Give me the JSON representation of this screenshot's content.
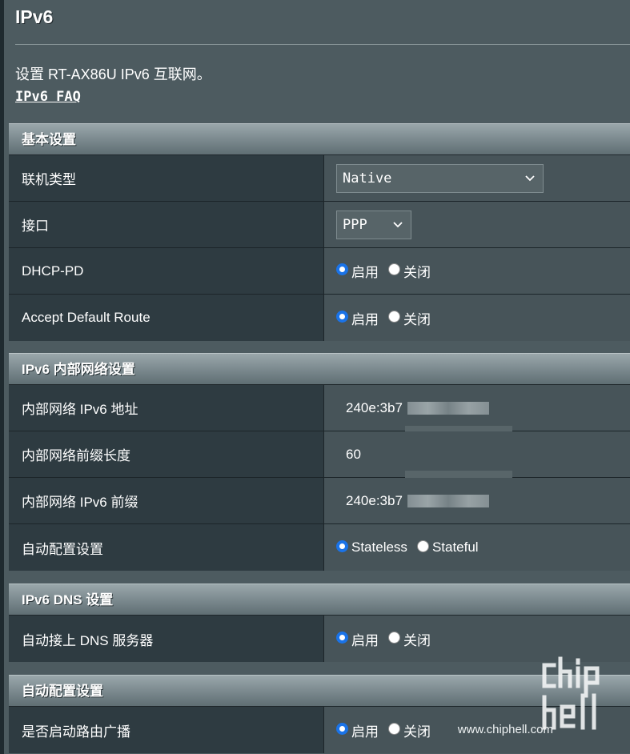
{
  "page": {
    "title": "IPv6",
    "description": "设置 RT-AX86U IPv6 互联网。",
    "faq_link": "IPv6 FAQ"
  },
  "sections": {
    "basic": {
      "header": "基本设置",
      "connection_type_label": "联机类型",
      "connection_type_value": "Native",
      "interface_label": "接口",
      "interface_value": "PPP",
      "dhcp_pd_label": "DHCP-PD",
      "accept_route_label": "Accept Default Route"
    },
    "lan": {
      "header": "IPv6 内部网络设置",
      "address_label": "内部网络 IPv6 地址",
      "address_value": "240e:3b7",
      "prefix_length_label": "内部网络前缀长度",
      "prefix_length_value": "60",
      "prefix_label": "内部网络 IPv6 前缀",
      "prefix_value": "240e:3b7",
      "autoconfig_label": "自动配置设置",
      "stateless": "Stateless",
      "stateful": "Stateful"
    },
    "dns": {
      "header": "IPv6 DNS 设置",
      "auto_dns_label": "自动接上 DNS 服务器"
    },
    "autoconf": {
      "header": "自动配置设置",
      "router_adv_label": "是否启动路由广播"
    }
  },
  "common": {
    "enable": "启用",
    "disable": "关闭"
  },
  "watermark": {
    "text": "www.chiphell.com"
  },
  "colors": {
    "radio_checked": "#1a73e8",
    "label_bg": "#2e3b41",
    "value_bg": "#475459"
  }
}
